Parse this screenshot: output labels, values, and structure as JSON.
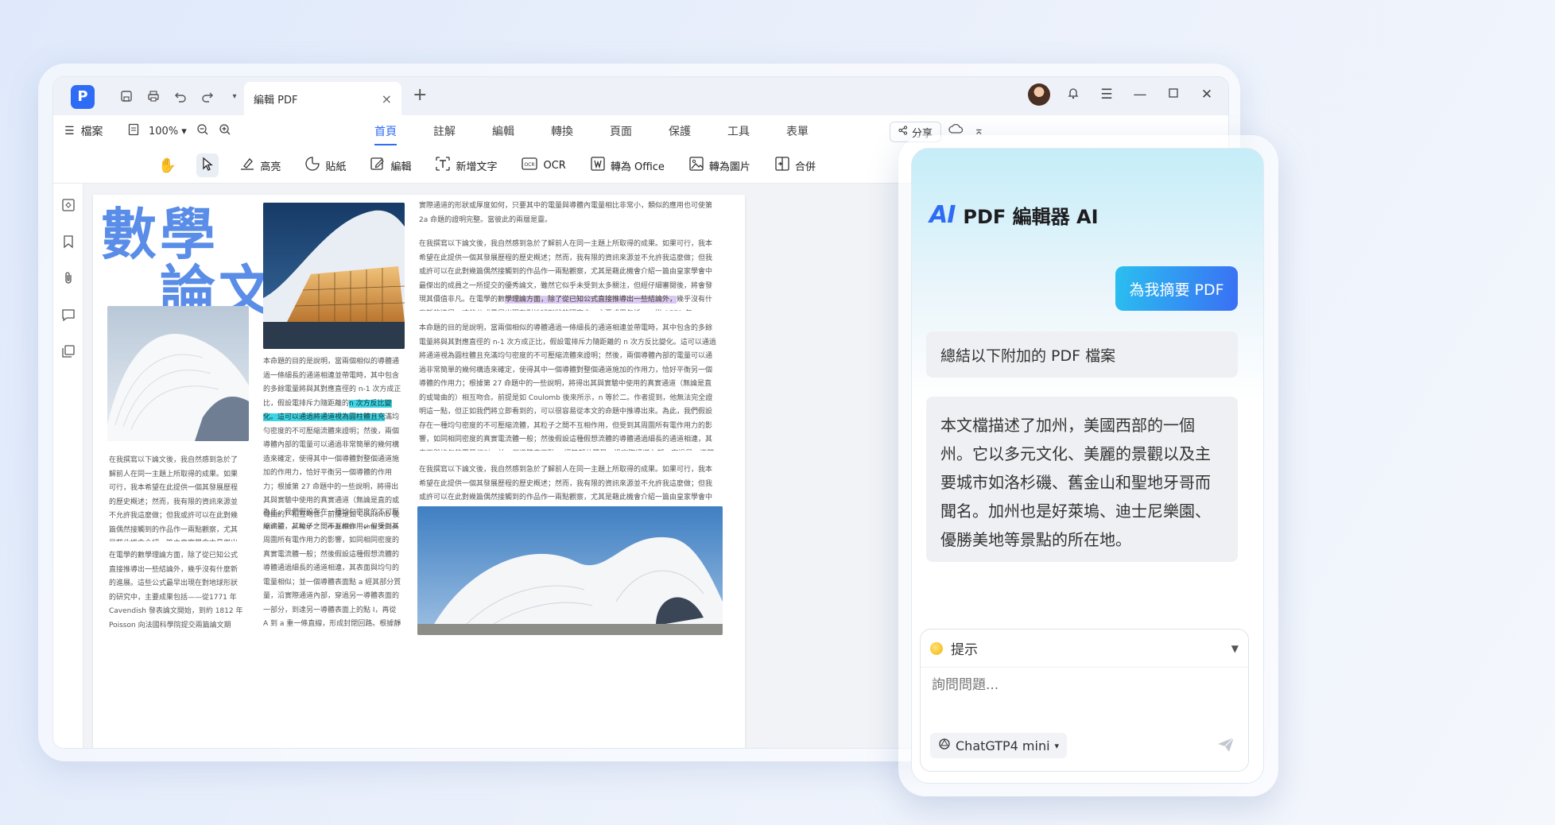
{
  "titlebar": {
    "app_logo": "P",
    "tab_title": "編輯 PDF",
    "tab_close": "×",
    "new_tab": "+"
  },
  "menubar": {
    "file_label": "檔案",
    "zoom_value": "100%",
    "tabs": [
      "首頁",
      "註解",
      "編輯",
      "轉換",
      "頁面",
      "保護",
      "工具",
      "表單"
    ],
    "active_tab": "首頁",
    "share_label": "分享"
  },
  "toolbar": {
    "tools": [
      {
        "icon": "hand-icon",
        "label": ""
      },
      {
        "icon": "cursor-icon",
        "label": ""
      },
      {
        "icon": "highlight-icon",
        "label": "高亮"
      },
      {
        "icon": "sticker-icon",
        "label": "貼紙"
      },
      {
        "icon": "edit-icon",
        "label": "編輯"
      },
      {
        "icon": "add-text-icon",
        "label": "新增文字"
      },
      {
        "icon": "ocr-icon",
        "label": "OCR"
      },
      {
        "icon": "to-office-icon",
        "label": "轉為 Office"
      },
      {
        "icon": "to-image-icon",
        "label": "轉為圖片"
      },
      {
        "icon": "merge-icon",
        "label": "合併"
      }
    ]
  },
  "document": {
    "title_line1": "數學",
    "title_line2": "論文",
    "col1_p1": "在我撰寫以下論文後，我自然感到急於了解前人在同一主題上所取得的成果。如果可行，我本希望在此提供一個其發展歷程的歷史概述；然而，我有限的資訊來源並不允許我這麼做；但我或許可以在此對幾篇偶然接觸到的作品作一兩點觀察，尤其是藉此機會介紹一篇由皇家學會中最傑出的成員之一所提交的優秀論文，雖然它似乎未受到太多關注，但經仔細審閱後，將會發現其價值非凡。",
    "col1_p2": "在電學的數學理論方面，除了從已知公式直接推導出一些結論外，幾乎沒有什麼新的進展。這些公式最早出現在對地球形狀的研究中，主要成果包括——從1771 年 Cavendish 發表論文開始，到約 1812 年Poisson 向法國科學院提交兩篇論文期間，對近似球形導體表面電荷密度規律的確定。這些導體先前已被置於相互接近，研究其電分佈。",
    "col2_p1": "本命題的目的是說明，當兩個相似的導體通過一條細長的通道相連並帶電時，其中包含的多餘電量將與其對應直徑的 n-1 次方成正比，假設電排斥力隨距離的",
    "col2_hl": "n 次方反比變化。這可以通過將通道視為圓柱體且充",
    "col2_p2": "滿均勻密度的不可壓縮流體來證明；然後，兩個導體內部的電量可以通過非常簡單的幾何構造來確定，使得其中一個導體對整個通道施加的作用力，恰好平衡另一個導體的作用力；根據第 27 命題中的一些說明，將得出其與實驗中使用的真實通道（無論是直的或彎曲的）相互吻合。前提是如 Coulomb 後來所示，n 等於二。作者提到，他無法完全證明這一點，但正如我們將立即看到的，可以很容易從本文的命題中推導出來。",
    "col2_p3": "為此，我們假設存在一種均勻密度的不可壓縮流體，其粒子之間不互相作用，但受到其周圍所有電作用力的影響，如同相同密度的真實電流體一般；然後假設這種假想流體的導體通過細長的通道相連，其表面與均勻的電量相似；並一個導體表面點 a 經其部分質量，沿實際通道內部，穿過另一導體表面的一部分，到達另一導體表面上的點 I，再從 A 到 a 重一條直線，形成封閉回路。根據靜力學原理，並可由作者的第 23 命題證明，整個假想通道將處於平衡狀態，且由於系統內部分流體的每個粒子必然被此，因此直線段 aA 也必然處於平衡。這一簡單的考慮完成了 Cavendish 的證明，無論",
    "col3_p0": "實際通道的形狀或厚度如何，只要其中的電量與導體內電量相比非常小，類似的應用也可使第 2a 命題的證明完整。當彼此的兩層是靈。",
    "col3_p1a": "在我撰寫以下論文後，我自然感到急於了解前人在同一主題上所取得的成果。如果可行，我本希望在此提供一個其發展歷程的歷史概述；然而，我有限的資訊來源並不允許我這麼做；但我或許可以在此對幾篇偶然接觸到的作品作一兩點觀察，尤其是藉此機會介紹一篇由皇家學會中最傑出的成員之一所提交的優秀論文，雖然它似乎未受到太多關注，但經仔細審閱後，將會發現其價值非凡。在電學的數",
    "col3_hl": "學理論方面，除了從已知公式直接推導出一些結論外，",
    "col3_p1b": "幾乎沒有什麼新的進展。這些公式最早出現在對地球形狀的研究中，主要成果包括——從 1771 年 Cavendish 發表論文開始，到約 1812 年 Poisson 向法國科學院提交兩篇論文期間，對近似球形導體表面電荷密度規律的確定。這些導體先前已被置於相互接近，研究其電分佈。",
    "col3_p2": "本命題的目的是說明，當兩個相似的導體通過一條細長的通道相連並帶電時，其中包含的多餘電量將與其對應直徑的 n-1 次方成正比，假設電排斥力隨距離的 n 次方反比變化。這可以通過將通道視為圓柱體且充滿均勻密度的不可壓縮流體來證明；然後，兩個導體內部的電量可以通過非常簡單的幾何構造來確定，使得其中一個導體對整個通道施加的作用力，恰好平衡另一個導體的作用力；根據第 27 命題中的一些說明，將得出其與實驗中使用的真實通道（無論是直的或彎曲的）相互吻合。前提是如 Coulomb 後來所示，n 等於二。作者提到，他無法完全證明這一點，但正如我們將立即看到的，可以很容易從本文的命題中推導出來。為此，我們假設存在一種均勻密度的不可壓縮流體，其粒子之間不互相作用，但受到其周圍所有電作用力的影響，如同相同密度的真實電流體一般；然後假設這種假想流體的導體通過細長的通道相連，其表面與均勻的電量相似；並一個導體表面點 a 經其部分質量，沿實際通道內部，穿過另一導體表面的一部分，到達另一導體表面上的點 I，再從 A 到 a 重一條直線，形成封閉回路。根據靜力學原理，並可由作者的第 23 命題證明，整個假想通道將處於平衡狀態，且由於系統內部分流體的每個粒子必然被此，因此直線段 aA 也必然處於平衡。這一簡單的考慮完成了 Cavendish 的證明，無論實際通道的形狀或厚度如何，只要其中的電量與導體內電量相比非常小，類似的應用也可使第 2a 命題的證明完整。當彼此的兩層是靈。",
    "col3_p3": "在我撰寫以下論文後，我自然感到急於了解前人在同一主題上所取得的成果。如果可行，我本希望在此提供一個其發展歷程的歷史概述；然而，我有限的資訊來源並不允許我這麼做；但我或許可以在此對幾篇偶然接觸到的作品作一兩點觀察，尤其是藉此機會介紹一篇由皇家學會中最傑出的成員之一所提交的優秀論文，雖然它似乎未受到太多關注，但經仔細審閱後，將會發現其價值非凡。"
  },
  "ai_panel": {
    "logo": "AI",
    "title": "PDF 編輯器 AI",
    "summary_button": "為我摘要 PDF",
    "user_message": "總結以下附加的 PDF 檔案",
    "ai_answer": "本文檔描述了加州，美國西部的一個州。它以多元文化、美麗的景觀以及主要城市如洛杉磯、舊金山和聖地牙哥而聞名。加州也是好萊塢、迪士尼樂園、優勝美地等景點的所在地。",
    "hint_label": "提示",
    "input_placeholder": "詢問問題...",
    "model_label": "ChatGTP4 mini"
  },
  "colors": {
    "accent": "#2f6cf5",
    "title_blue": "#5a8de8",
    "highlight_cyan": "#3ed6e6",
    "highlight_purple": "#d9c7f4"
  }
}
